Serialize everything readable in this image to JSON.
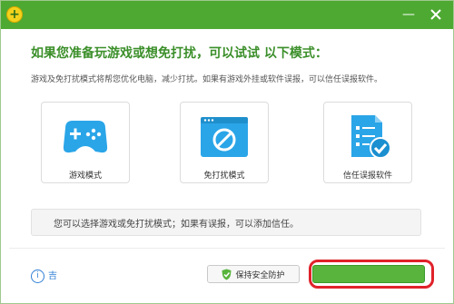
{
  "window": {
    "title": "",
    "minimize_icon": "minimize-icon",
    "close_icon": "close-icon",
    "accent_color": "#4ea932"
  },
  "main": {
    "headline": "如果您准备玩游戏或想免打扰，可以试试 以下模式：",
    "subtext": "游戏及免打扰模式将帮您优化电脑，减少打扰。如果有游戏外挂或软件误报，可以信任误报软件。"
  },
  "cards": [
    {
      "label": "游戏模式",
      "icon": "gamepad-icon"
    },
    {
      "label": "免打扰模式",
      "icon": "no-disturb-icon"
    },
    {
      "label": "信任误报软件",
      "icon": "trust-checklist-icon"
    }
  ],
  "info": {
    "text": "您可以选择游戏或免打扰模式；如果有误报，可以添加信任。"
  },
  "footer": {
    "link_label": "吉",
    "keep_button_label": "保持安全防护",
    "enter_button_label": ""
  }
}
